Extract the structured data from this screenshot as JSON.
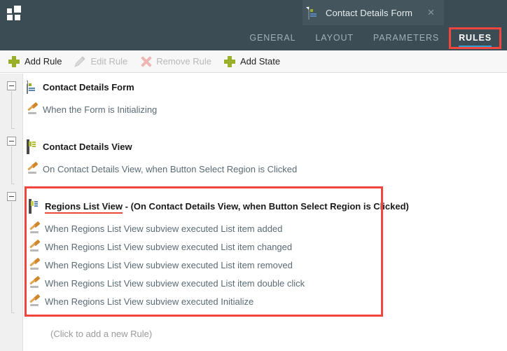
{
  "app": {
    "logo_name": "app-grid-logo",
    "header_bg": "#3c4c55",
    "accent_blue": "#2e9fd8",
    "annotation_red": "#f2453d",
    "plus_green": "#9aaf28"
  },
  "document_tab": {
    "title": "Contact Details Form",
    "icon": "form-document-icon",
    "close_label": "×"
  },
  "nav_tabs": [
    {
      "label": "GENERAL",
      "active": false
    },
    {
      "label": "LAYOUT",
      "active": false
    },
    {
      "label": "PARAMETERS",
      "active": false
    },
    {
      "label": "RULES",
      "active": true
    }
  ],
  "toolbar": {
    "add_rule_label": "Add Rule",
    "edit_rule_label": "Edit Rule",
    "remove_rule_label": "Remove Rule",
    "add_state_label": "Add State"
  },
  "tree": {
    "groups": [
      {
        "title": "Contact Details Form",
        "title_underlined": "",
        "title_rest": "",
        "icon": "form-document-icon",
        "expanded": true,
        "rules": [
          "When the Form is Initializing"
        ]
      },
      {
        "title": "Contact Details View",
        "title_underlined": "",
        "title_rest": "",
        "icon": "view-green-icon",
        "expanded": true,
        "rules": [
          "On Contact Details View, when Button Select Region is Clicked"
        ]
      },
      {
        "title": "Regions List View - (On Contact Details View, when Button Select Region is Clicked)",
        "title_underlined": "Regions List View",
        "title_rest": " - (On Contact Details View, when Button Select Region is Clicked)",
        "icon": "view-blue-icon",
        "expanded": true,
        "rules": [
          "When Regions List View subview executed List item added",
          "When Regions List View subview executed List item changed",
          "When Regions List View subview executed List item removed",
          "When Regions List View subview executed List item double click",
          "When Regions List View subview executed Initialize"
        ]
      }
    ],
    "add_new_rule_label": "(Click to add a new Rule)"
  },
  "annotations": {
    "rules_tab_highlight": "RULES",
    "group_highlight": "Regions List View group"
  }
}
